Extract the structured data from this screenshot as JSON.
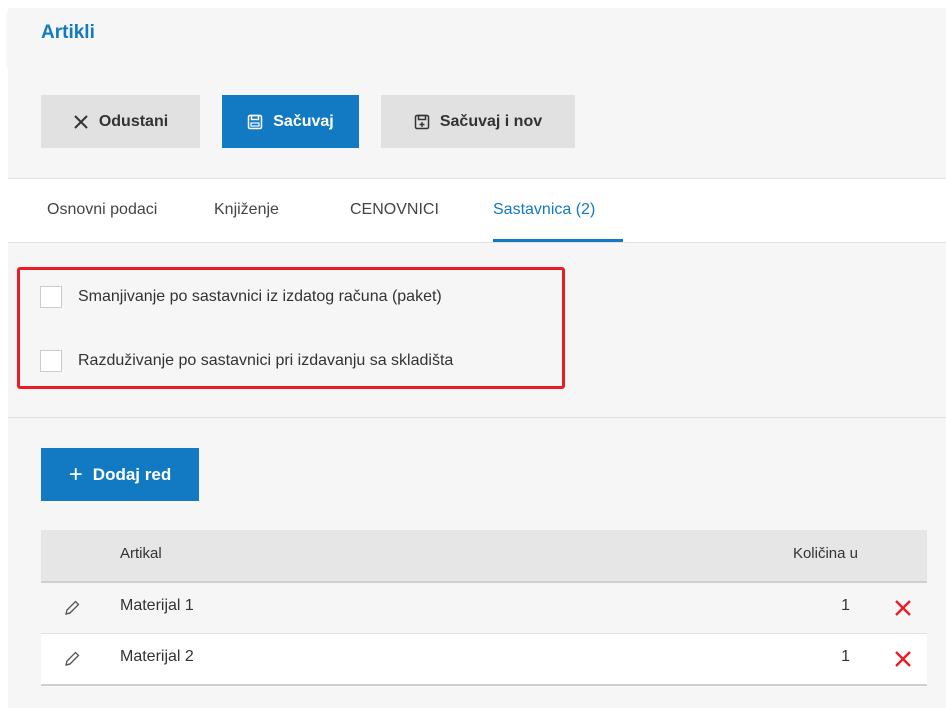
{
  "header": {
    "title": "Artikli"
  },
  "toolbar": {
    "cancel_label": "Odustani",
    "save_label": "Sačuvaj",
    "save_new_label": "Sačuvaj i nov"
  },
  "tabs": [
    {
      "label": "Osnovni podaci",
      "active": false
    },
    {
      "label": "Knjiženje",
      "active": false
    },
    {
      "label": "CENOVNICI",
      "active": false
    },
    {
      "label": "Sastavnica (2)",
      "active": true
    }
  ],
  "options": {
    "items": [
      {
        "label": "Smanjivanje po sastavnici iz izdatog računa (paket)",
        "checked": false
      },
      {
        "label": "Razduživanje po sastavnici pri izdavanju sa skladišta",
        "checked": false
      }
    ]
  },
  "components": {
    "add_row_label": "Dodaj red",
    "columns": {
      "article": "Artikal",
      "quantity": "Količina u"
    },
    "rows": [
      {
        "article": "Materijal 1",
        "quantity": "1"
      },
      {
        "article": "Materijal 2",
        "quantity": "1"
      }
    ]
  },
  "icons": {
    "cancel": "close-icon",
    "save": "floppy-disk-icon",
    "save_new": "floppy-disk-plus-icon",
    "add": "plus-icon",
    "edit": "pencil-icon",
    "delete": "delete-x-icon"
  },
  "colors": {
    "accent": "#1279c3",
    "delete": "#ec1c24",
    "highlight_border": "#ec1c24"
  }
}
